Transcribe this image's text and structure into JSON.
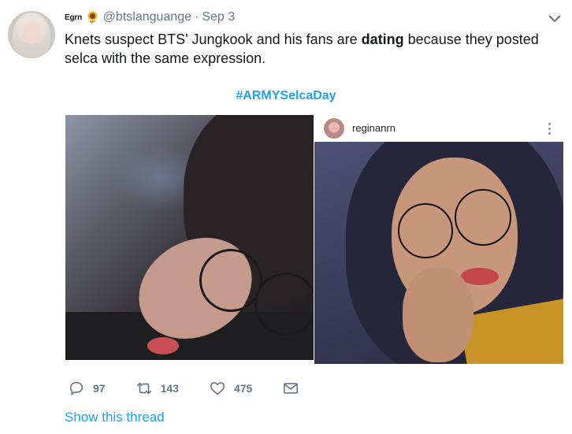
{
  "author": {
    "display_name": "Egrn",
    "emoji": "🌻",
    "handle": "@btslanguange",
    "separator": "·",
    "date": "Sep 3"
  },
  "text": {
    "part1": "Knets suspect BTS' Jungkook and his fans are ",
    "bold": "dating",
    "part2": " because they posted selca with the same expression."
  },
  "hashtag": "#ARMYSelcaDay",
  "instagram_card": {
    "username": "reginanrn"
  },
  "actions": {
    "replies": "97",
    "retweets": "143",
    "likes": "475"
  },
  "show_thread_label": "Show this thread",
  "colors": {
    "link": "#1da1f2",
    "muted": "#657786",
    "text": "#14171a"
  },
  "icons": [
    "sunflower-icon",
    "caret-down-icon",
    "reply-icon",
    "retweet-icon",
    "heart-icon",
    "direct-message-icon",
    "more-options-icon"
  ]
}
